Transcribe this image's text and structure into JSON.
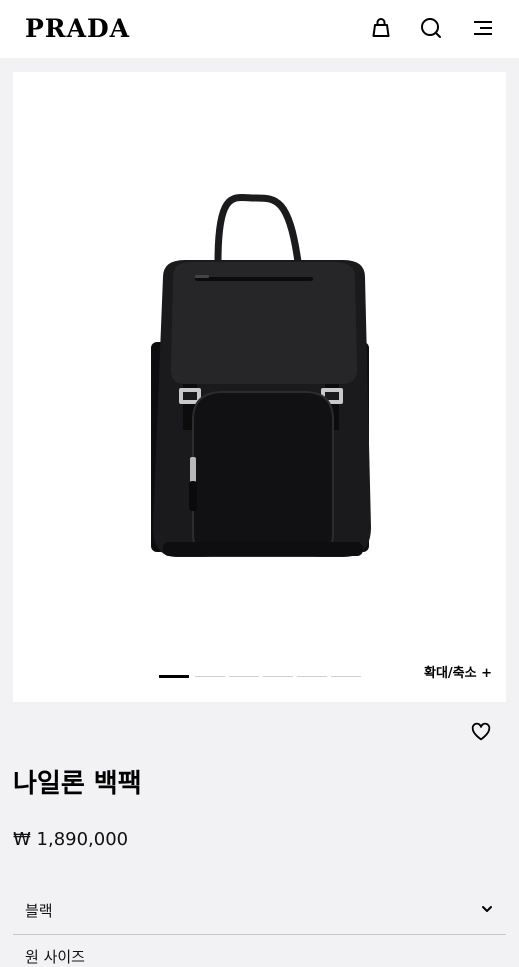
{
  "header": {
    "logo": "PRADA",
    "icons": [
      "bag-icon",
      "search-icon",
      "menu-icon"
    ]
  },
  "gallery": {
    "image_alt": "black nylon backpack",
    "slide_count": 6,
    "active_slide": 1,
    "zoom_label": "확대/축소 +"
  },
  "product": {
    "name": "나일론 백팩",
    "price": "₩ 1,890,000",
    "color_selected": "블랙",
    "size_label": "원 사이즈"
  },
  "colors": {
    "page_bg": "#f2f2f4",
    "card_bg": "#ffffff",
    "text": "#111111"
  }
}
